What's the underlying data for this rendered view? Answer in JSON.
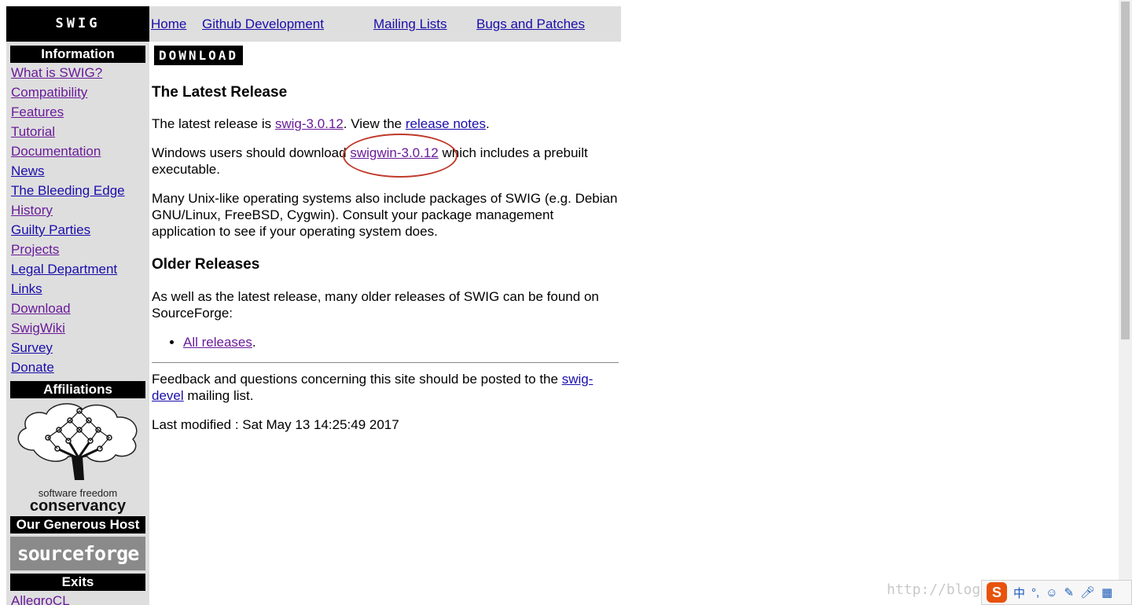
{
  "logo_text": "SWIG",
  "topnav": {
    "home": "Home",
    "github": "Github Development",
    "mailing": "Mailing Lists",
    "bugs": "Bugs and Patches"
  },
  "sidebar": {
    "information_heading": "Information",
    "info_links": [
      "What is SWIG?",
      "Compatibility",
      "Features",
      "Tutorial",
      "Documentation",
      "News",
      "The Bleeding Edge",
      "History",
      "Guilty Parties",
      "Projects",
      "Legal Department",
      "Links",
      "Download",
      "SwigWiki",
      "Survey",
      "Donate"
    ],
    "affiliations_heading": "Affiliations",
    "conservancy_line1": "software freedom",
    "conservancy_line2": "conservancy",
    "host_heading": "Our Generous Host",
    "sourceforge_logo": "sourceforge",
    "exits_heading": "Exits",
    "exit_links": [
      "AllegroCL"
    ]
  },
  "main": {
    "download_banner": "DOWNLOAD",
    "latest_heading": "The Latest Release",
    "latest_pre": "The latest release is ",
    "latest_link": "swig-3.0.12",
    "latest_mid": ". View the ",
    "release_notes_link": "release notes",
    "latest_post": ".",
    "windows_pre": "Windows users should download ",
    "windows_link": "swigwin-3.0.12",
    "windows_post": " which includes a prebuilt executable.",
    "unix_para": "Many Unix-like operating systems also include packages of SWIG (e.g. Debian GNU/Linux, FreeBSD, Cygwin). Consult your package management application to see if your operating system does.",
    "older_heading": "Older Releases",
    "older_para": "As well as the latest release, many older releases of SWIG can be found on SourceForge:",
    "all_releases_link": "All releases",
    "all_releases_post": ".",
    "feedback_pre": "Feedback and questions concerning this site should be posted to the ",
    "feedback_link": "swig-devel",
    "feedback_post": " mailing list.",
    "last_modified": "Last modified : Sat May 13 14:25:49 2017"
  },
  "watermark": "http://blog.",
  "ime": {
    "logo": "S",
    "lang": "中"
  }
}
